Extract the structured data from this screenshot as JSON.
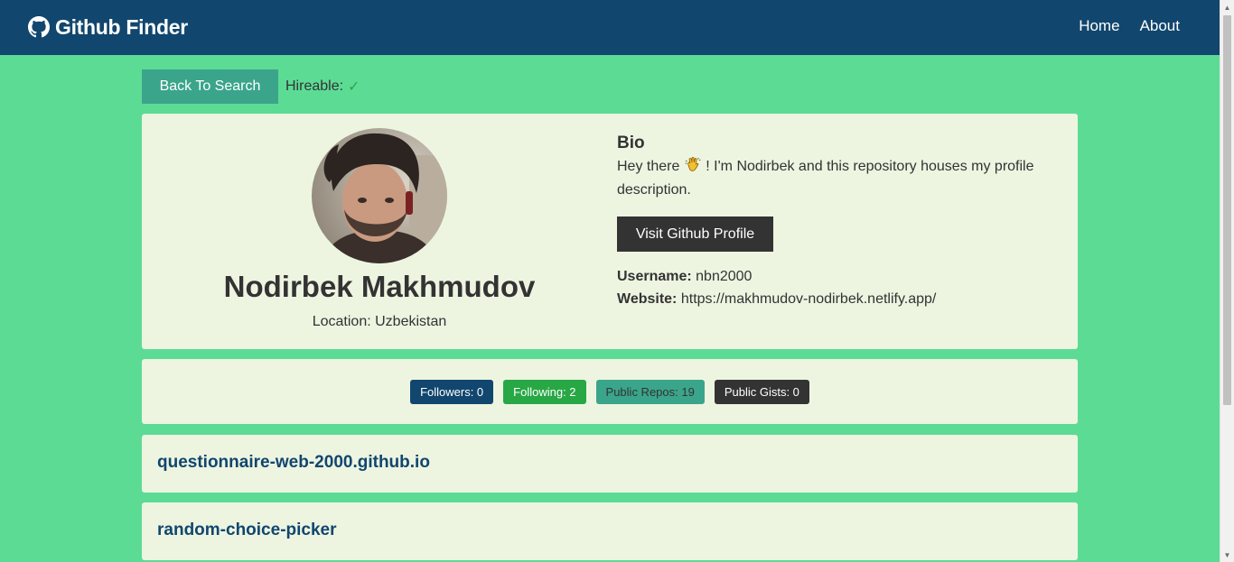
{
  "navbar": {
    "brand": "Github Finder",
    "brand_icon": "github-icon",
    "links": [
      "Home",
      "About"
    ]
  },
  "actions": {
    "back_label": "Back To Search",
    "hireable_label": "Hireable:",
    "hireable_icon": "check-icon"
  },
  "profile": {
    "name": "Nodirbek Makhmudov",
    "location": "Location: Uzbekistan",
    "bio_heading": "Bio",
    "bio_before": "Hey there",
    "bio_after": "! I'm Nodirbek and this repository houses my profile description.",
    "visit_label": "Visit Github Profile",
    "username_label": "Username:",
    "username": "nbn2000",
    "website_label": "Website:",
    "website": "https://makhmudov-nodirbek.netlify.app/"
  },
  "stats": {
    "followers": "Followers: 0",
    "following": "Following: 2",
    "repos": "Public Repos: 19",
    "gists": "Public Gists: 0"
  },
  "repos": [
    "questionnaire-web-2000.github.io",
    "random-choice-picker"
  ],
  "colors": {
    "background": "#5cdb95",
    "navbar": "#11466e",
    "card": "#edf5e1",
    "accent": "#3aa58b",
    "dark": "#333333",
    "success": "#28a745"
  }
}
